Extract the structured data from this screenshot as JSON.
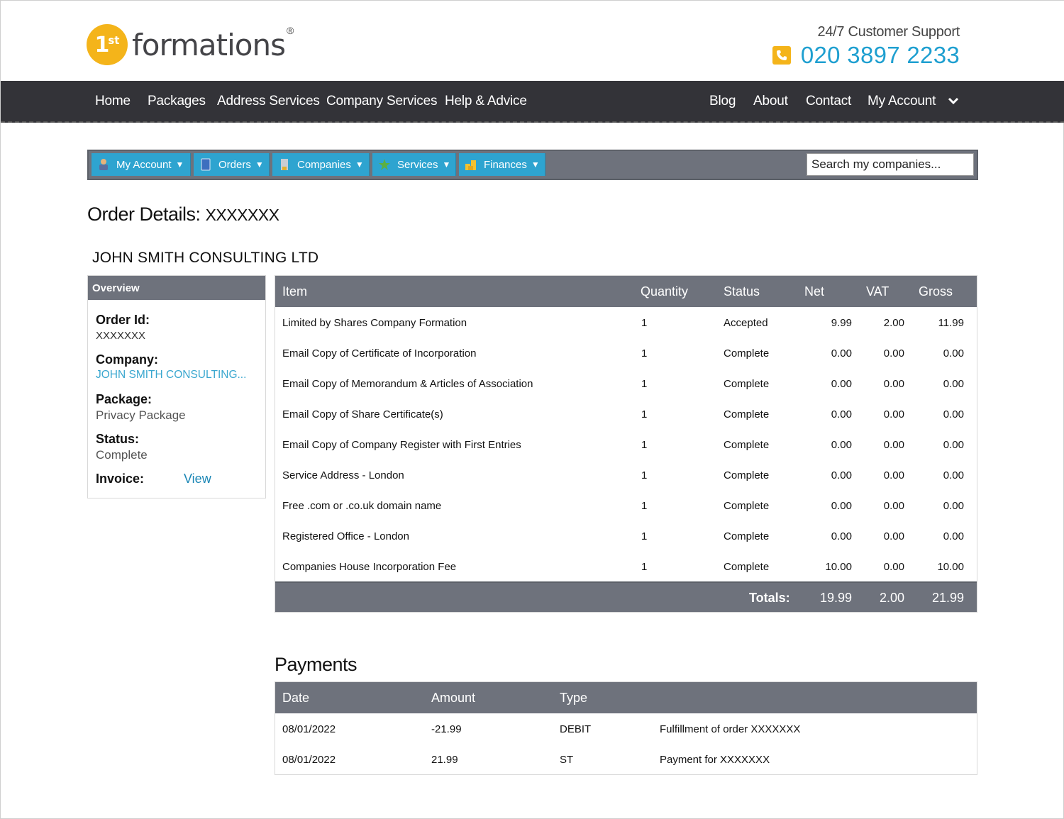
{
  "brand": {
    "logo_mark": "1",
    "logo_sup": "st",
    "logo_text": "formations",
    "logo_reg": "®",
    "accent_color": "#f4b41a",
    "link_color": "#1e9fd0"
  },
  "support": {
    "label": "24/7 Customer Support",
    "phone": "020 3897 2233",
    "icon": "phone-icon"
  },
  "main_nav": {
    "left": [
      "Home",
      "Packages",
      "Address Services",
      "Company Services",
      "Help & Advice"
    ],
    "right": [
      "Blog",
      "About",
      "Contact",
      "My Account"
    ],
    "account_chevron": "❯"
  },
  "toolbar": {
    "buttons": [
      {
        "label": "My Account",
        "icon": "user-icon"
      },
      {
        "label": "Orders",
        "icon": "orders-book-icon"
      },
      {
        "label": "Companies",
        "icon": "building-icon"
      },
      {
        "label": "Services",
        "icon": "services-star-icon"
      },
      {
        "label": "Finances",
        "icon": "coins-icon"
      }
    ],
    "dropdown_arrow": "▼",
    "search_placeholder": "Search my companies..."
  },
  "page": {
    "title": "Order Details:",
    "order_id": "XXXXXXX",
    "company_name": "JOHN SMITH CONSULTING LTD"
  },
  "overview": {
    "heading": "Overview",
    "order_id_label": "Order Id:",
    "order_id_value": "XXXXXXX",
    "company_label": "Company:",
    "company_value": "JOHN SMITH CONSULTING...",
    "package_label": "Package:",
    "package_value": "Privacy Package",
    "status_label": "Status:",
    "status_value": "Complete",
    "invoice_label": "Invoice:",
    "invoice_link": "View"
  },
  "items_table": {
    "headers": [
      "Item",
      "Quantity",
      "Status",
      "Net",
      "VAT",
      "Gross"
    ],
    "rows": [
      {
        "item": "Limited by Shares Company Formation",
        "qty": "1",
        "status": "Accepted",
        "net": "9.99",
        "vat": "2.00",
        "gross": "11.99"
      },
      {
        "item": "Email Copy of Certificate of Incorporation",
        "qty": "1",
        "status": "Complete",
        "net": "0.00",
        "vat": "0.00",
        "gross": "0.00"
      },
      {
        "item": "Email Copy of Memorandum & Articles of Association",
        "qty": "1",
        "status": "Complete",
        "net": "0.00",
        "vat": "0.00",
        "gross": "0.00"
      },
      {
        "item": "Email Copy of Share Certificate(s)",
        "qty": "1",
        "status": "Complete",
        "net": "0.00",
        "vat": "0.00",
        "gross": "0.00"
      },
      {
        "item": "Email Copy of Company Register with First Entries",
        "qty": "1",
        "status": "Complete",
        "net": "0.00",
        "vat": "0.00",
        "gross": "0.00"
      },
      {
        "item": "Service Address - London",
        "qty": "1",
        "status": "Complete",
        "net": "0.00",
        "vat": "0.00",
        "gross": "0.00"
      },
      {
        "item": "Free .com or .co.uk domain name",
        "qty": "1",
        "status": "Complete",
        "net": "0.00",
        "vat": "0.00",
        "gross": "0.00"
      },
      {
        "item": "Registered Office - London",
        "qty": "1",
        "status": "Complete",
        "net": "0.00",
        "vat": "0.00",
        "gross": "0.00"
      },
      {
        "item": "Companies House Incorporation Fee",
        "qty": "1",
        "status": "Complete",
        "net": "10.00",
        "vat": "0.00",
        "gross": "10.00"
      }
    ],
    "totals": {
      "label": "Totals:",
      "net": "19.99",
      "vat": "2.00",
      "gross": "21.99"
    }
  },
  "payments": {
    "title": "Payments",
    "headers": [
      "Date",
      "Amount",
      "Type"
    ],
    "rows": [
      {
        "date": "08/01/2022",
        "amount": "-21.99",
        "type": "DEBIT",
        "description": "Fulfillment of order XXXXXXX"
      },
      {
        "date": "08/01/2022",
        "amount": "21.99",
        "type": "ST",
        "description": "Payment for XXXXXXX"
      }
    ]
  }
}
